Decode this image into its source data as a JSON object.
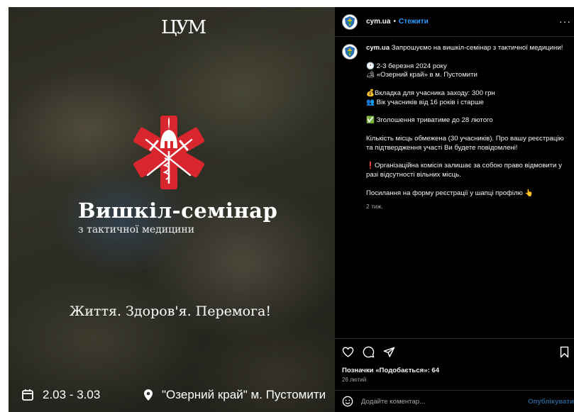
{
  "post_image": {
    "logo_text": "ЦУМ",
    "title": "Вишкіл-семінар",
    "subtitle": "з тактичної медицини",
    "slogan": "Життя. Здоров'я. Перемога!",
    "dates": "2.03 - 3.03",
    "place": "\"Озерний край\" м. Пустомити",
    "colors": {
      "emblem_red": "#d7262e"
    }
  },
  "header": {
    "username": "cym.ua",
    "separator": "•",
    "follow_label": "Стежити",
    "more_icon": "more-horizontal-icon",
    "more_label": "···"
  },
  "caption": {
    "username": "cym.ua",
    "lines": [
      "Запрошуємо на вишкіл-семінар з тактичної медицини!",
      "🕐 2-3 березня 2024 року",
      "🏕 «Озерний край» в м. Пустомити",
      "💰Вкладка для учасника заходу: 300 грн",
      "👥 Вік учасників від 16 років і старше",
      "✅ Зголошення триватиме до 28 лютого",
      "Кількість місць обмежена (30 учасників). Про вашу реєстрацію та підтвердження участі Ви будете повідомлені!",
      "❗Організаційна комісія залишає за собою право відмовити у разі відсутності вільних місць.",
      "Посилання на форму реєстрації у шапці профілю 👆"
    ],
    "time": "2 тиж."
  },
  "actions": {
    "likes_text": "Позначки «Подобається»: 64",
    "date": "26 лютий"
  },
  "comment": {
    "placeholder": "Додайте коментар...",
    "publish_label": "Опублікувати"
  }
}
